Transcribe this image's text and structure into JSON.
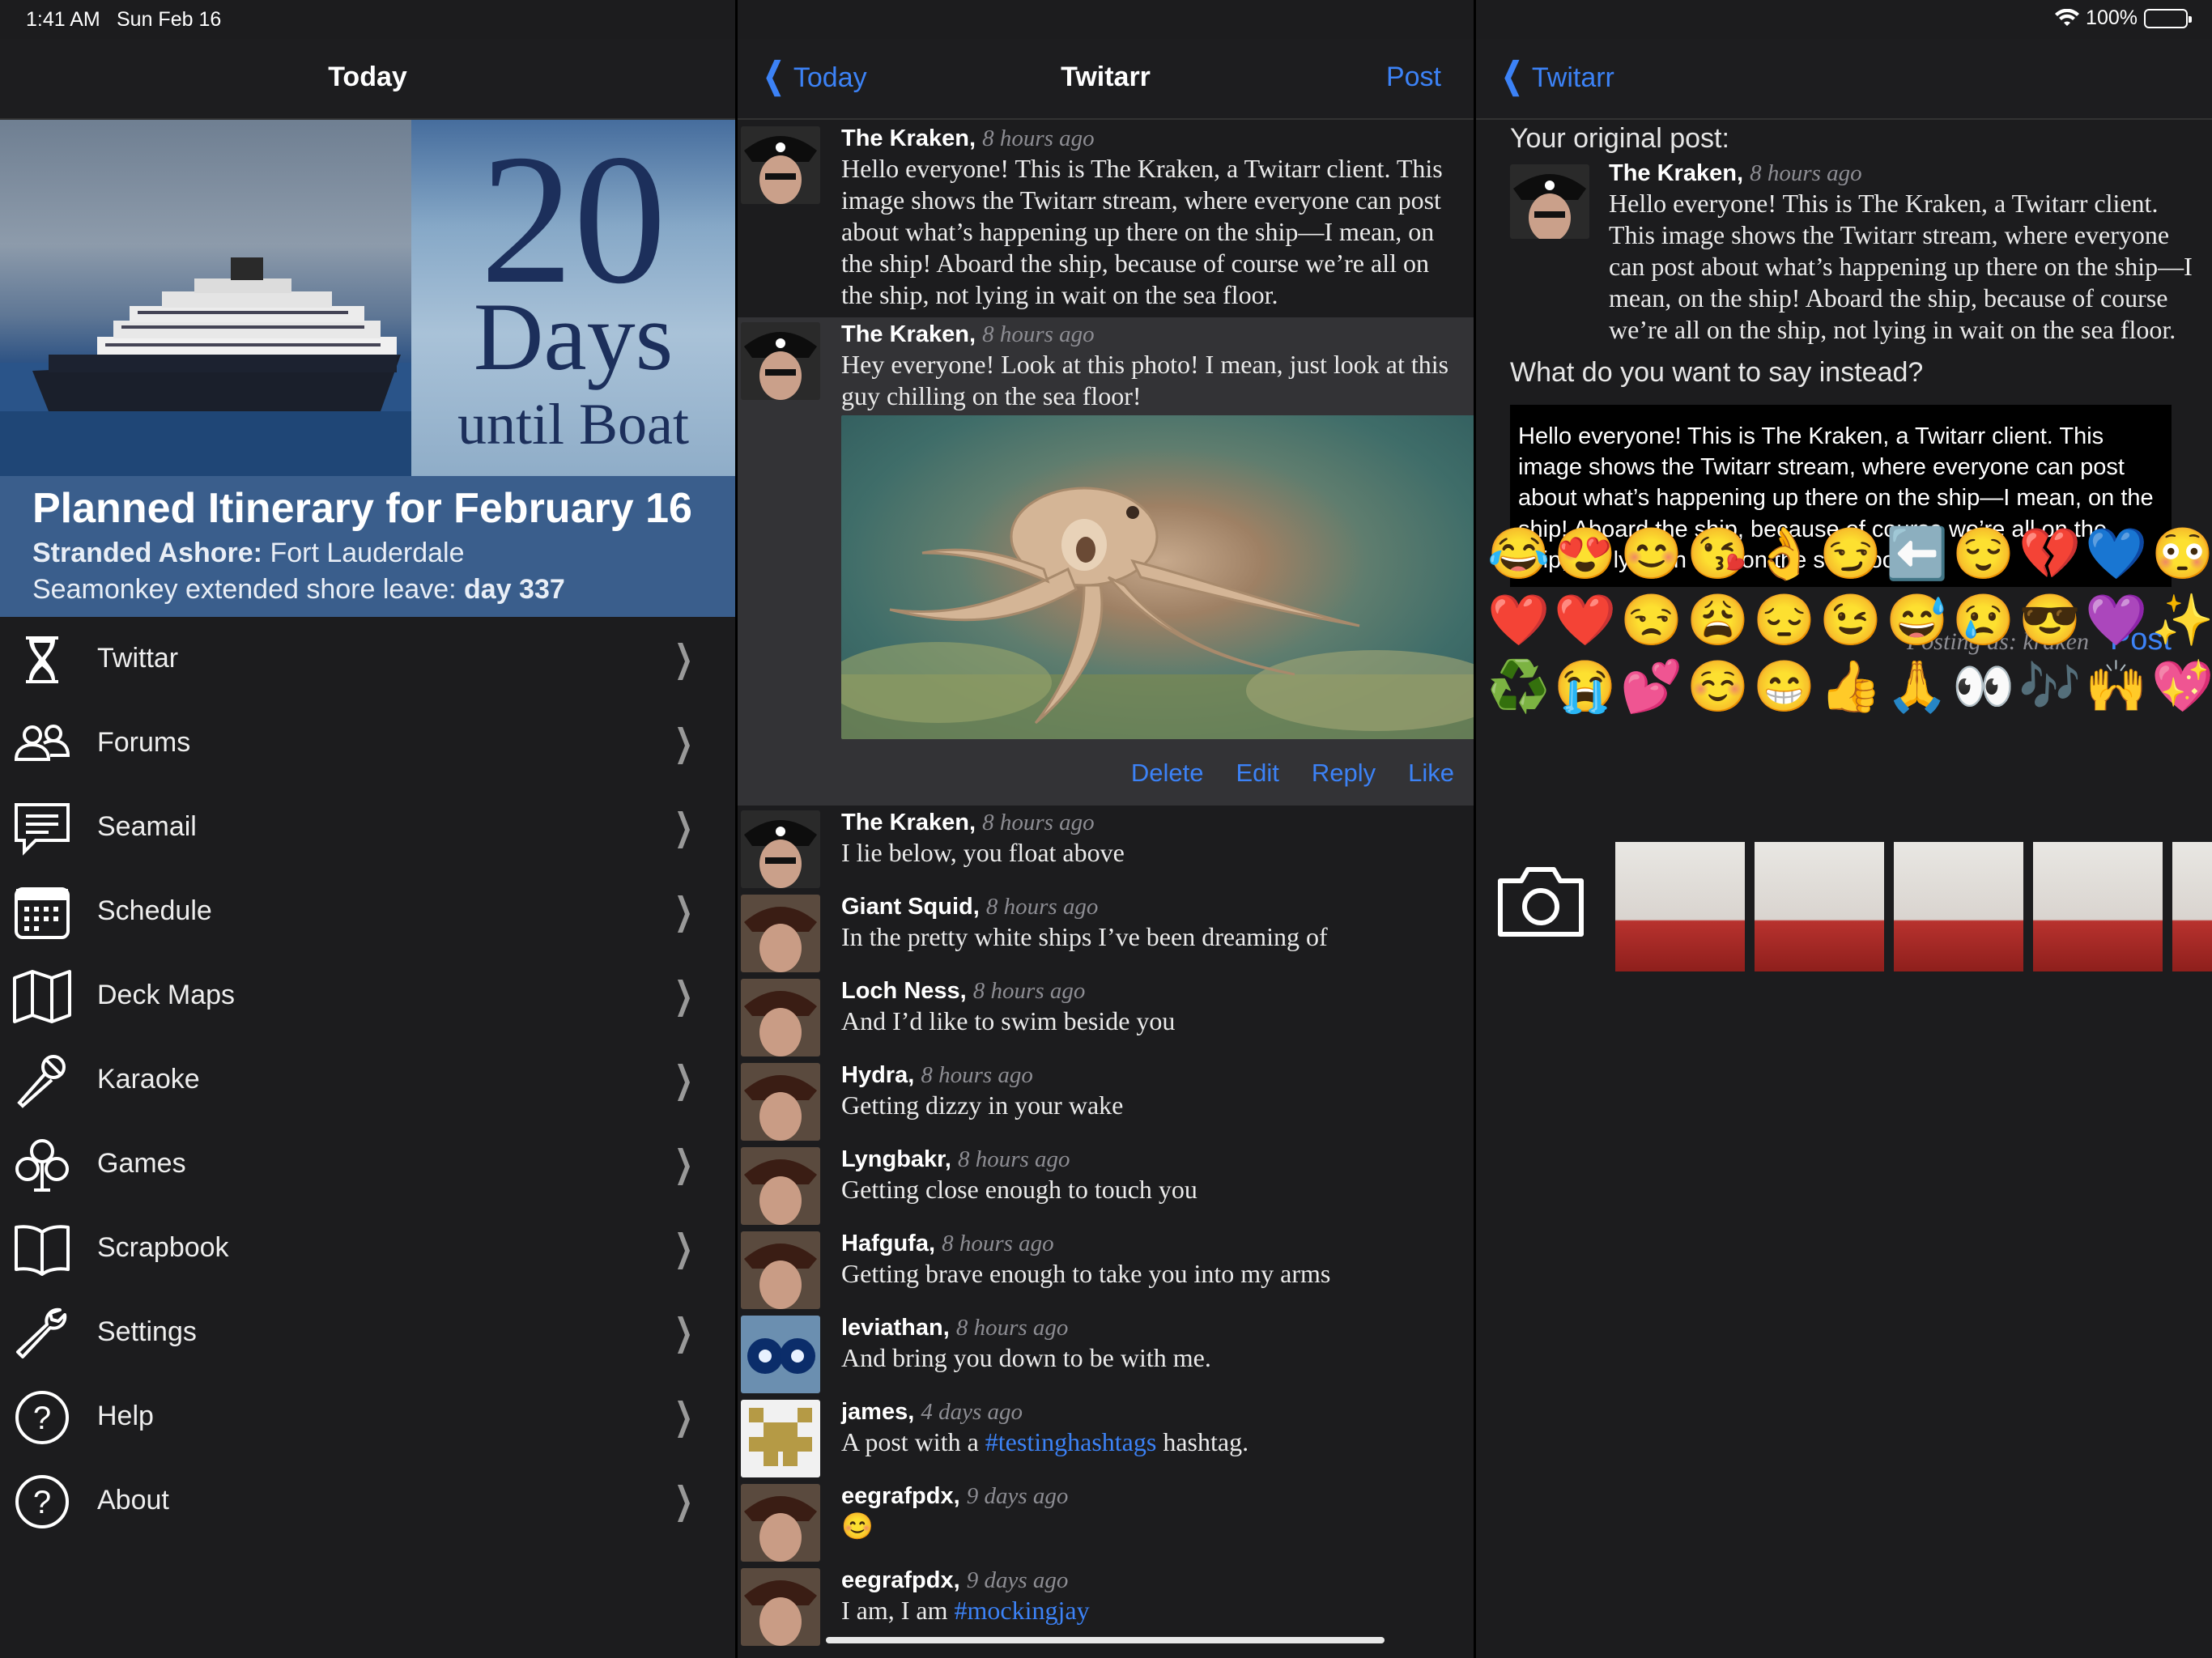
{
  "status": {
    "time": "1:41 AM",
    "date": "Sun Feb 16",
    "battery": "100%"
  },
  "left": {
    "title": "Today",
    "countdown": {
      "number": "20",
      "days": "Days",
      "until": "until Boat"
    },
    "itinerary": {
      "heading": "Planned Itinerary for February 16",
      "stranded_label": "Stranded Ashore:",
      "stranded_value": " Fort Lauderdale",
      "leave_label": "Seamonkey extended shore leave: ",
      "leave_value": "day 337"
    },
    "menu": [
      {
        "label": "Twittar",
        "icon": "hourglass-icon"
      },
      {
        "label": "Forums",
        "icon": "people-icon"
      },
      {
        "label": "Seamail",
        "icon": "chat-bubble-icon"
      },
      {
        "label": "Schedule",
        "icon": "calendar-icon"
      },
      {
        "label": "Deck Maps",
        "icon": "map-icon"
      },
      {
        "label": "Karaoke",
        "icon": "microphone-icon"
      },
      {
        "label": "Games",
        "icon": "club-icon"
      },
      {
        "label": "Scrapbook",
        "icon": "book-icon"
      },
      {
        "label": "Settings",
        "icon": "wrench-icon"
      },
      {
        "label": "Help",
        "icon": "question-icon"
      },
      {
        "label": "About",
        "icon": "question-icon"
      }
    ]
  },
  "middle": {
    "back": "Today",
    "title": "Twitarr",
    "action": "Post",
    "posts": [
      {
        "author": "The Kraken,",
        "time": "8 hours ago",
        "text": "Hello everyone! This is The Kraken, a Twitarr client. This image shows the Twitarr stream, where everyone can post about what’s happening up there on the ship—I mean, on the ship! Aboard the ship, because of course we’re all on the ship, not lying in wait on the sea floor."
      },
      {
        "author": "The Kraken,",
        "time": "8 hours ago",
        "text": "Hey everyone! Look at this photo! I mean, just look at this guy chilling on the sea floor!"
      },
      {
        "author": "The Kraken,",
        "time": "8 hours ago",
        "text": "I lie below, you float above"
      },
      {
        "author": "Giant Squid,",
        "time": "8 hours ago",
        "text": "In the pretty white ships I’ve been dreaming of"
      },
      {
        "author": "Loch Ness,",
        "time": "8 hours ago",
        "text": "And I’d like to swim beside you"
      },
      {
        "author": "Hydra,",
        "time": "8 hours ago",
        "text": "Getting dizzy in your wake"
      },
      {
        "author": "Lyngbakr,",
        "time": "8 hours ago",
        "text": "Getting close enough to touch you"
      },
      {
        "author": "Hafgufa,",
        "time": "8 hours ago",
        "text": "Getting brave enough to take you into my arms"
      },
      {
        "author": "leviathan,",
        "time": "8 hours ago",
        "text": "And bring you down to be with me."
      },
      {
        "author": "james,",
        "time": "4 days ago",
        "text_before": "A post with a ",
        "tag": "#testinghashtags",
        "text_after": " hashtag."
      },
      {
        "author": "eegrafpdx,",
        "time": "9 days ago",
        "emoji": "😊"
      },
      {
        "author": "eegrafpdx,",
        "time": "9 days ago",
        "text_before": "I am, I am ",
        "tag": "#mockingjay"
      }
    ],
    "actions": {
      "delete": "Delete",
      "edit": "Edit",
      "reply": "Reply",
      "like": "Like"
    }
  },
  "right": {
    "back": "Twitarr",
    "original_heading": "Your original post:",
    "original": {
      "author": "The Kraken,",
      "time": "8 hours ago",
      "text": "Hello everyone! This is The Kraken, a Twitarr client. This image shows the Twitarr stream, where everyone can post about what’s happening up there on the ship—I mean, on the ship! Aboard the ship, because of course we’re all on the ship, not lying in wait on the sea floor."
    },
    "prompt": "What do you want to say instead?",
    "draft": "Hello everyone! This is The Kraken, a Twitarr client. This image shows the Twitarr stream, where everyone can post about what’s happening up there on the ship—I mean, on the ship! Aboard the ship, because of course we’re all on the ship, not lying in wait on the sea floor.",
    "posting_as": "Posting as: kraken",
    "post_button": "Post",
    "emojis": [
      "😂",
      "😍",
      "😊",
      "😘",
      "👌",
      "😏",
      "⬅️",
      "😌",
      "💔",
      "💙",
      "😳",
      "❤️",
      "❤️",
      "😒",
      "😩",
      "😔",
      "😉",
      "😅",
      "😢",
      "😎",
      "💜",
      "✨",
      "♻️",
      "😭",
      "💕",
      "☺️",
      "😁",
      "👍",
      "🙏",
      "👀",
      "🎶",
      "🙌",
      "💖"
    ]
  }
}
